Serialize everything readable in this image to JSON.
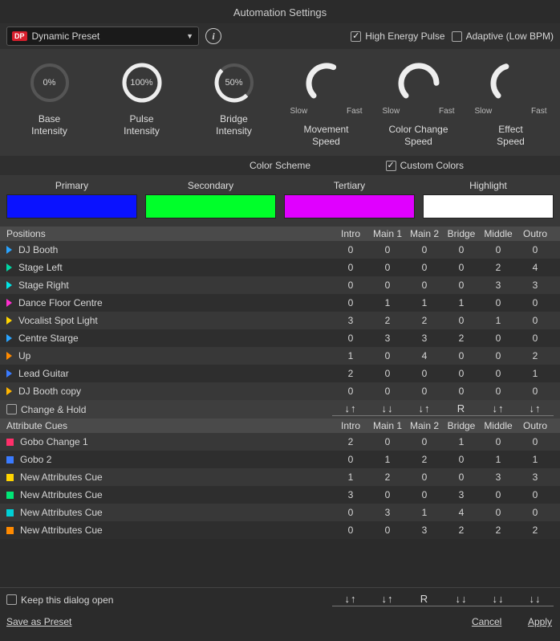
{
  "title": "Automation Settings",
  "preset": {
    "badge": "DP",
    "label": "Dynamic Preset"
  },
  "top_checks": {
    "high_energy": "High Energy Pulse",
    "adaptive": "Adaptive (Low BPM)"
  },
  "dials": {
    "base": {
      "label1": "Base",
      "label2": "Intensity",
      "value_text": "0%"
    },
    "pulse": {
      "label1": "Pulse",
      "label2": "Intensity",
      "value_text": "100%"
    },
    "bridge": {
      "label1": "Bridge",
      "label2": "Intensity",
      "value_text": "50%"
    },
    "move": {
      "label1": "Movement",
      "label2": "Speed",
      "slow": "Slow",
      "fast": "Fast"
    },
    "color": {
      "label1": "Color Change",
      "label2": "Speed",
      "slow": "Slow",
      "fast": "Fast"
    },
    "effect": {
      "label1": "Effect",
      "label2": "Speed",
      "slow": "Slow",
      "fast": "Fast"
    }
  },
  "scheme": {
    "title": "Color Scheme",
    "custom_label": "Custom Colors",
    "primary": {
      "label": "Primary",
      "color": "#0a12ff"
    },
    "secondary": {
      "label": "Secondary",
      "color": "#00ff2a"
    },
    "tertiary": {
      "label": "Tertiary",
      "color": "#e000ff"
    },
    "highlight": {
      "label": "Highlight",
      "color": "#ffffff"
    }
  },
  "positions": {
    "header": "Positions",
    "cols": {
      "c1": "Intro",
      "c2": "Main 1",
      "c3": "Main 2",
      "c4": "Bridge",
      "c5": "Middle",
      "c6": "Outro"
    },
    "rows": [
      {
        "marker": "#2aa4ff",
        "name": "DJ Booth",
        "v": [
          "0",
          "0",
          "0",
          "0",
          "0",
          "0"
        ]
      },
      {
        "marker": "#00d6a3",
        "name": "Stage Left",
        "v": [
          "0",
          "0",
          "0",
          "0",
          "2",
          "4"
        ]
      },
      {
        "marker": "#00e6e6",
        "name": "Stage Right",
        "v": [
          "0",
          "0",
          "0",
          "0",
          "3",
          "3"
        ]
      },
      {
        "marker": "#ff2fd0",
        "name": "Dance Floor Centre",
        "v": [
          "0",
          "1",
          "1",
          "1",
          "0",
          "0"
        ]
      },
      {
        "marker": "#ffd400",
        "name": "Vocalist Spot Light",
        "v": [
          "3",
          "2",
          "2",
          "0",
          "1",
          "0"
        ]
      },
      {
        "marker": "#2aa4ff",
        "name": "Centre Starge",
        "v": [
          "0",
          "3",
          "3",
          "2",
          "0",
          "0"
        ]
      },
      {
        "marker": "#ff8a00",
        "name": "Up",
        "v": [
          "1",
          "0",
          "4",
          "0",
          "0",
          "2"
        ]
      },
      {
        "marker": "#3a7bff",
        "name": "Lead Guitar",
        "v": [
          "2",
          "0",
          "0",
          "0",
          "0",
          "1"
        ]
      },
      {
        "marker": "#ffb500",
        "name": "DJ Booth copy",
        "v": [
          "0",
          "0",
          "0",
          "0",
          "0",
          "0"
        ]
      }
    ],
    "change_hold": "Change & Hold",
    "arrows": [
      "↓↑",
      "↓↓",
      "↓↑",
      "R",
      "↓↑",
      "↓↑"
    ]
  },
  "attributes": {
    "header": "Attribute Cues",
    "cols": {
      "c1": "Intro",
      "c2": "Main 1",
      "c3": "Main 2",
      "c4": "Bridge",
      "c5": "Middle",
      "c6": "Outro"
    },
    "rows": [
      {
        "marker": "#ff2f6a",
        "name": "Gobo Change 1",
        "v": [
          "2",
          "0",
          "0",
          "1",
          "0",
          "0"
        ]
      },
      {
        "marker": "#3a7bff",
        "name": "Gobo 2",
        "v": [
          "0",
          "1",
          "2",
          "0",
          "1",
          "1"
        ]
      },
      {
        "marker": "#ffd400",
        "name": "New Attributes Cue",
        "v": [
          "1",
          "2",
          "0",
          "0",
          "3",
          "3"
        ]
      },
      {
        "marker": "#00e676",
        "name": "New Attributes Cue",
        "v": [
          "3",
          "0",
          "0",
          "3",
          "0",
          "0"
        ]
      },
      {
        "marker": "#00d0d6",
        "name": "New Attributes Cue",
        "v": [
          "0",
          "3",
          "1",
          "4",
          "0",
          "0"
        ]
      },
      {
        "marker": "#ff8a00",
        "name": "New Attributes Cue",
        "v": [
          "0",
          "0",
          "3",
          "2",
          "2",
          "2"
        ]
      }
    ]
  },
  "footer": {
    "keep_open": "Keep this dialog open",
    "arrows": [
      "↓↑",
      "↓↑",
      "R",
      "↓↓",
      "↓↓",
      "↓↓"
    ],
    "save_preset": "Save as Preset",
    "cancel": "Cancel",
    "apply": "Apply"
  }
}
